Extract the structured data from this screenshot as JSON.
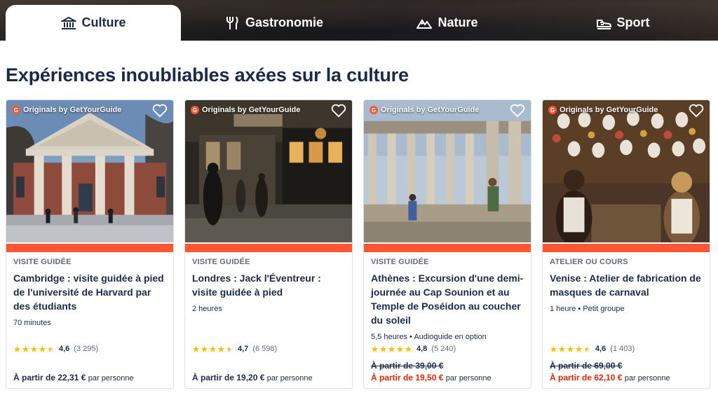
{
  "tabs": [
    {
      "label": "Culture",
      "icon": "museum-icon",
      "active": true
    },
    {
      "label": "Gastronomie",
      "icon": "cutlery-icon",
      "active": false
    },
    {
      "label": "Nature",
      "icon": "mountain-icon",
      "active": false
    },
    {
      "label": "Sport",
      "icon": "running-shoe-icon",
      "active": false
    }
  ],
  "section": {
    "title": "Expériences inoubliables axées sur la culture"
  },
  "colors": {
    "brand_orange": "#ff5533",
    "text_dark": "#1a2b49",
    "sale_red": "#eb2400",
    "star_yellow": "#ffc107"
  },
  "badge_label": "Originals by GetYourGuide",
  "badge_logo_letter": "G",
  "cards": [
    {
      "category": "Visite guidée",
      "title": "Cambridge : visite guidée à pied de l'université de Harvard par des étudiants",
      "meta": "70 minutes",
      "rating_value": "4,6",
      "rating_count": "(3 295)",
      "rating_stars": 4.5,
      "old_price": "",
      "price": "À partir de 22,31 €",
      "per_person": "par personne",
      "on_sale": false
    },
    {
      "category": "Visite guidée",
      "title": "Londres : Jack l'Éventreur : visite guidée à pied",
      "meta": "2 heures",
      "rating_value": "4,7",
      "rating_count": "(6 598)",
      "rating_stars": 4.5,
      "old_price": "",
      "price": "À partir de 19,20 €",
      "per_person": "par personne",
      "on_sale": false
    },
    {
      "category": "Visite guidée",
      "title": "Athènes : Excursion d'une demi-journée au Cap Sounion et au Temple de Poséidon au coucher du soleil",
      "meta": "5,5 heures • Audioguide en option",
      "rating_value": "4,8",
      "rating_count": "(5 240)",
      "rating_stars": 5,
      "old_price": "À partir de 39,00 €",
      "price": "À partir de 19,50 €",
      "per_person": "par personne",
      "on_sale": true
    },
    {
      "category": "Atelier ou cours",
      "title": "Venise : Atelier de fabrication de masques de carnaval",
      "meta": "1 heure • Petit groupe",
      "rating_value": "4,6",
      "rating_count": "(1 403)",
      "rating_stars": 4.5,
      "old_price": "À partir de 69,00 €",
      "price": "À partir de 62,10 €",
      "per_person": "par personne",
      "on_sale": true
    }
  ]
}
